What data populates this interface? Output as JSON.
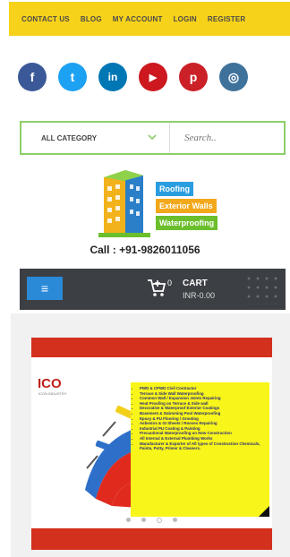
{
  "nav": {
    "contact": "CONTACT US",
    "blog": "BLOG",
    "account": "MY ACCOUNT",
    "login": "LOGIN",
    "register": "REGISTER"
  },
  "social": [
    {
      "name": "facebook",
      "glyph": "f",
      "color": "#3b5998"
    },
    {
      "name": "twitter",
      "glyph": "t",
      "color": "#1da1f2"
    },
    {
      "name": "linkedin",
      "glyph": "in",
      "color": "#0077b5"
    },
    {
      "name": "youtube",
      "glyph": "▶",
      "color": "#cc181e"
    },
    {
      "name": "pinterest",
      "glyph": "p",
      "color": "#cb2027"
    },
    {
      "name": "instagram",
      "glyph": "◎",
      "color": "#3f729b"
    }
  ],
  "search": {
    "category": "ALL CATEGORY",
    "placeholder": "Search.."
  },
  "logo": {
    "badge1": "Roofing",
    "badge2": "Exterior Walls",
    "badge3": "Waterproofing",
    "badge1_color": "#2a9de0",
    "badge2_color": "#f2a81a",
    "badge3_color": "#6cbf2c"
  },
  "call": "Call : +91-9826011056",
  "cart": {
    "menu_glyph": "≡",
    "count": "0",
    "title": "CART",
    "total": "INR-0.00"
  },
  "slide": {
    "brand": "ICO",
    "brand_sub": "ICON INDUSTRY",
    "services": [
      "PWD & CPWD Civil Contractor",
      "Terrace & Side Wall Waterproofing",
      "Common Wall / Expansion Joints Repairing",
      "Heat Proofing on Terrace & Side wall",
      "Decorative & Waterproof Exterior Coatings",
      "Basement & Swimming Pool Waterproofing",
      "Epoxy & PU Flooring / Grouting",
      "Asbestos & GI Sheets / Rooves Repairing",
      "Industrial PU Coating & Painting",
      "Precautional Waterproofing on New Construction",
      "All Internal & External Plumbing Works",
      "Manufacturer & Exporter of All types of Construction Chemicals, Paints, Putty, Primer & Cleaners."
    ]
  }
}
